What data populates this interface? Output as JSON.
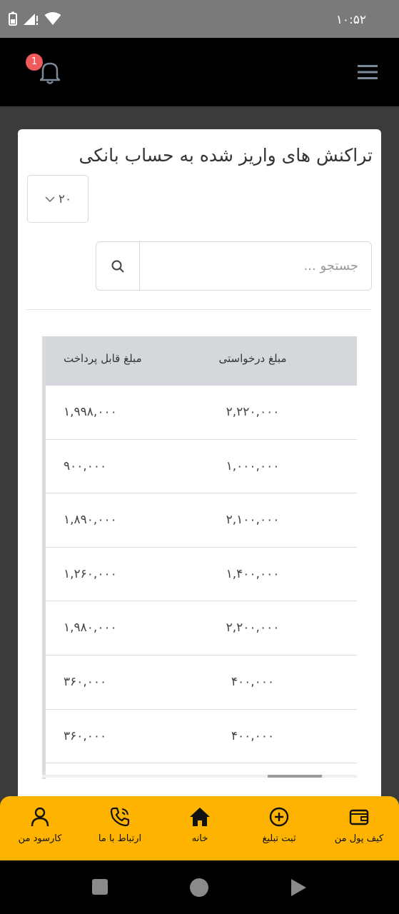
{
  "status_bar": {
    "time": "۱۰:۵۲",
    "icons": [
      "battery-icon",
      "signal-icon",
      "wifi-icon"
    ]
  },
  "header": {
    "notification_count": "1",
    "icons": [
      "bell-icon",
      "menu-icon"
    ]
  },
  "card": {
    "title": "تراکنش های واریز شده به حساب بانکی",
    "page_size": "۲۰",
    "search": {
      "placeholder": "جستجو ...",
      "value": ""
    }
  },
  "table": {
    "headers": {
      "requested": "مبلغ درخواستی",
      "payable": "مبلغ قابل پرداخت"
    },
    "rows": [
      {
        "requested": "۲,۲۲۰,۰۰۰",
        "payable": "۱,۹۹۸,۰۰۰"
      },
      {
        "requested": "۱,۰۰۰,۰۰۰",
        "payable": "۹۰۰,۰۰۰"
      },
      {
        "requested": "۲,۱۰۰,۰۰۰",
        "payable": "۱,۸۹۰,۰۰۰"
      },
      {
        "requested": "۱,۴۰۰,۰۰۰",
        "payable": "۱,۲۶۰,۰۰۰"
      },
      {
        "requested": "۲,۲۰۰,۰۰۰",
        "payable": "۱,۹۸۰,۰۰۰"
      },
      {
        "requested": "۴۰۰,۰۰۰",
        "payable": "۳۶۰,۰۰۰"
      },
      {
        "requested": "۴۰۰,۰۰۰",
        "payable": "۳۶۰,۰۰۰"
      }
    ]
  },
  "bottom_nav": {
    "items": [
      {
        "label": "کارسود من",
        "icon": "user-icon"
      },
      {
        "label": "ارتباط با ما",
        "icon": "phone-icon"
      },
      {
        "label": "خانه",
        "icon": "home-icon"
      },
      {
        "label": "ثبت تبلیغ",
        "icon": "plus-circle-icon"
      },
      {
        "label": "کیف پول من",
        "icon": "wallet-icon"
      }
    ],
    "background": "#fdb300"
  },
  "system_nav": {
    "icons": [
      "recents-icon",
      "home-circle-icon",
      "back-icon"
    ]
  }
}
